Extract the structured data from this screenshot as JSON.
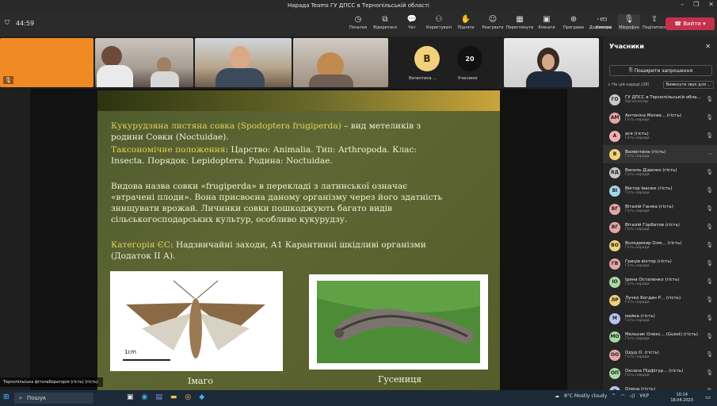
{
  "window": {
    "title": "Нарада Teams ГУ ДПСС в Тернопільській області"
  },
  "toolbar": {
    "timer": "44:59",
    "items": [
      {
        "label": "Початки",
        "icon": "clock-icon"
      },
      {
        "label": "Відкритися",
        "icon": "pop-out-icon"
      },
      {
        "label": "Чат",
        "icon": "chat-icon"
      },
      {
        "label": "Користувачі",
        "icon": "people-icon"
      },
      {
        "label": "Підняти",
        "icon": "raise-hand-icon"
      },
      {
        "label": "Реагувати",
        "icon": "react-icon"
      },
      {
        "label": "Переглянути",
        "icon": "view-icon"
      },
      {
        "label": "Кімнати",
        "icon": "rooms-icon"
      },
      {
        "label": "Програми",
        "icon": "apps-icon"
      },
      {
        "label": "Додатково",
        "icon": "more-icon"
      }
    ],
    "camera": "Камера",
    "mic": "Мікрофон",
    "share": "Поділитися",
    "leave": "Вийти"
  },
  "tiles": {
    "valentyna_avatar": "В",
    "valentyna_label": "Валентина ...",
    "participants_count": "20",
    "participants_label": "Учасники"
  },
  "slide": {
    "line1_title": "Кукурудзяна листяна совка (Spodoptera frugiperda)",
    "line1_rest": " – вид метеликів з",
    "line2": "родини Совки (Noctuidae).",
    "tax_title": "Таксономічне положення",
    "tax_rest": ": Царство: Animalia. Тип: Arthropoda. Клас:",
    "tax_line2": "Insecta. Порядок: Lepidoptera. Родина: Noctuidae.",
    "para1": "Видова назва совки «frugiperda» в перекладі  з латинської означає",
    "para2": "«втрачені плоди». Вона присвоєна даному організму через його здатність",
    "para3": "знищувати врожай. Личинки совки пошкоджують  багато видів",
    "para4": "сільськогосподарських культур, особливо кукурудзу.",
    "cat_title": "Категорія ЄС",
    "cat_rest": ": Надзвичайні заходи, А1 Карантинні шкідливі організми",
    "cat_line2": "(Додаток ІІ А).",
    "scale": "1cm",
    "caption1": "Імаго",
    "caption2": "Гусениця"
  },
  "presenter_caption": "Тернопільська фітолабораторія (гість) (гість)",
  "sidebar": {
    "title": "Учасники",
    "share_btn": "Поширити запрошення",
    "section": "∨ На цій нараді (28)",
    "mute_all": "Вимкнути звук для ...",
    "participants": [
      {
        "initials": "ГО",
        "name": "ГУ ДПСС в Тернопільській обла...",
        "role": "Організатор",
        "color": "#c9c9c9"
      },
      {
        "initials": "АМ",
        "name": "Антоніна Матве... (гість)",
        "role": "Гість наради",
        "color": "#e6a6a6"
      },
      {
        "initials": "А",
        "name": "ася (гість)",
        "role": "Гість наради",
        "color": "#f0b0b0"
      },
      {
        "initials": "В",
        "name": "Валентина (гість)",
        "role": "Гість наради",
        "color": "#f1d27a"
      },
      {
        "initials": "ВД",
        "name": "Василь Діденко (гість)",
        "role": "Гість наради",
        "color": "#c7c7c7"
      },
      {
        "initials": "ВІ",
        "name": "Віктор Івасюк (гість)",
        "role": "Гість наради",
        "color": "#9fd7e6"
      },
      {
        "initials": "ВГ",
        "name": "Віталій Ганжа (гість)",
        "role": "Гість наради",
        "color": "#e6a6a6"
      },
      {
        "initials": "ВГ",
        "name": "Віталій Горбатов (гість)",
        "role": "Гість наради",
        "color": "#e6a6a6"
      },
      {
        "initials": "ВО",
        "name": "Володимир Олм... (гість)",
        "role": "Гість наради",
        "color": "#f1d27a"
      },
      {
        "initials": "ГВ",
        "name": "Гриців віктор (гість)",
        "role": "Гість наради",
        "color": "#e6a6a6"
      },
      {
        "initials": "ІО",
        "name": "Ірина Остапенко (гість)",
        "role": "Гість наради",
        "color": "#a6d9a6"
      },
      {
        "initials": "ЛР",
        "name": "Лучко Богдан Р... (гість)",
        "role": "Гість наради",
        "color": "#f1d27a"
      },
      {
        "initials": "М",
        "name": "майка (гість)",
        "role": "Гість наради",
        "color": "#b7c3f0"
      },
      {
        "initials": "МО",
        "name": "Мельник Олекс... (Guest) (гість)",
        "role": "Гість наради",
        "color": "#a6d9a6"
      },
      {
        "initials": "ОО",
        "name": "Одуд О. (гість)",
        "role": "Гість наради",
        "color": "#e6a6a6"
      },
      {
        "initials": "ОП",
        "name": "Оксана Підфігур... (гість)",
        "role": "Гість наради",
        "color": "#a6d9a6"
      },
      {
        "initials": "О",
        "name": "Олена (гість)",
        "role": "Гість наради",
        "color": "#b7c3f0"
      }
    ]
  },
  "taskbar": {
    "search": "Пошук",
    "weather": "8°C  Mostly cloudy",
    "lang": "УКР",
    "time": "10:14",
    "date": "18.04.2023"
  }
}
